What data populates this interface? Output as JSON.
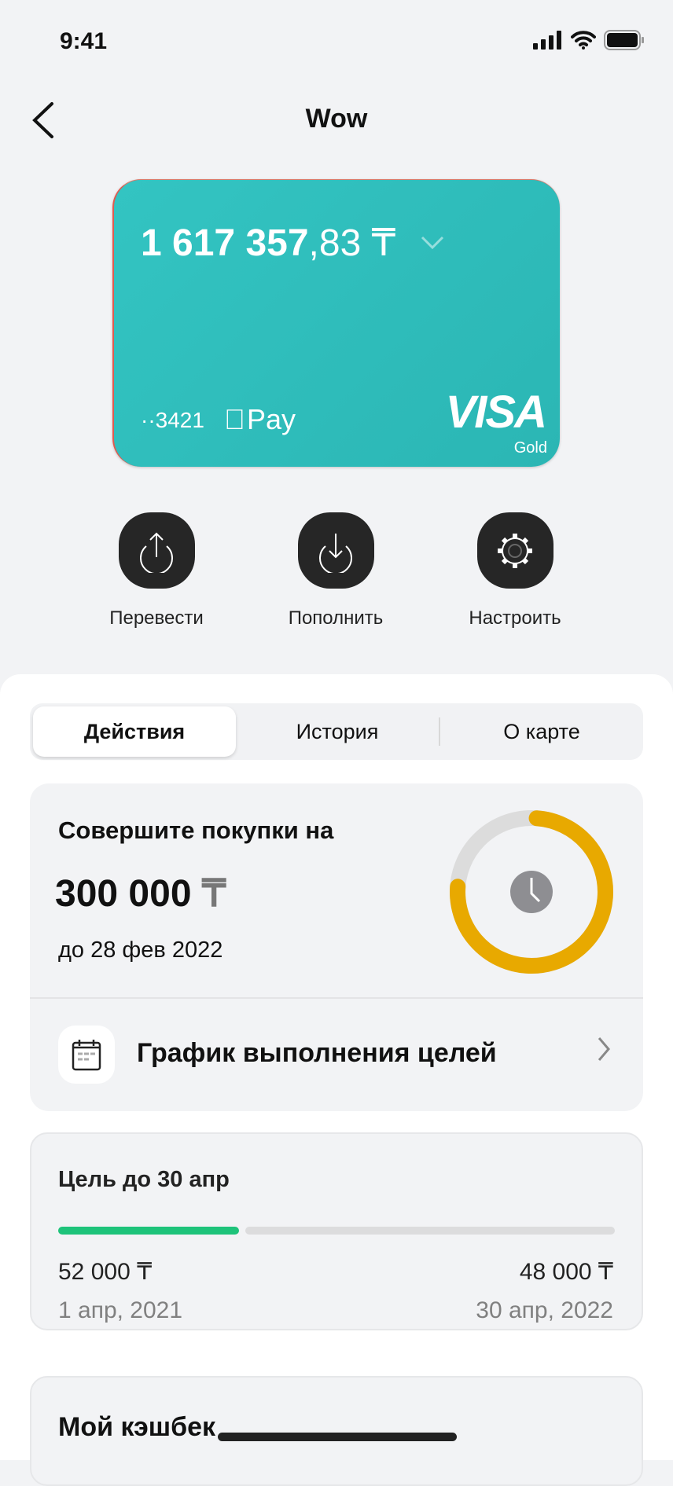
{
  "status": {
    "time": "9:41"
  },
  "header": {
    "title": "Wow"
  },
  "card": {
    "balance_int": "1 617 357",
    "balance_dec": ",83 ₸",
    "last4": "··3421",
    "pay": "Pay",
    "brand": "VISA",
    "tier": "Gold",
    "color": "#2fbfbd"
  },
  "actions": [
    {
      "label": "Перевести",
      "icon": "upload-icon"
    },
    {
      "label": "Пополнить",
      "icon": "download-icon"
    },
    {
      "label": "Настроить",
      "icon": "gear-icon"
    }
  ],
  "tabs": [
    {
      "label": "Действия",
      "active": true
    },
    {
      "label": "История"
    },
    {
      "label": "О карте"
    }
  ],
  "challenge": {
    "heading": "Совершите покупки на",
    "amount": "300 000",
    "currency": "₸",
    "deadline": "до 28 фев 2022",
    "progress": 0.75,
    "ring_color": "#e8a900",
    "link": "График выполнения целей"
  },
  "goal": {
    "title": "Цель до 30 апр",
    "progress": 0.33,
    "left_value": "52 000 ₸",
    "left_date": "1 апр, 2021",
    "right_value": "48 000 ₸",
    "right_date": "30 апр, 2022",
    "bar_color": "#1ec37a"
  },
  "cashback": {
    "title": "Мой кэшбек"
  }
}
